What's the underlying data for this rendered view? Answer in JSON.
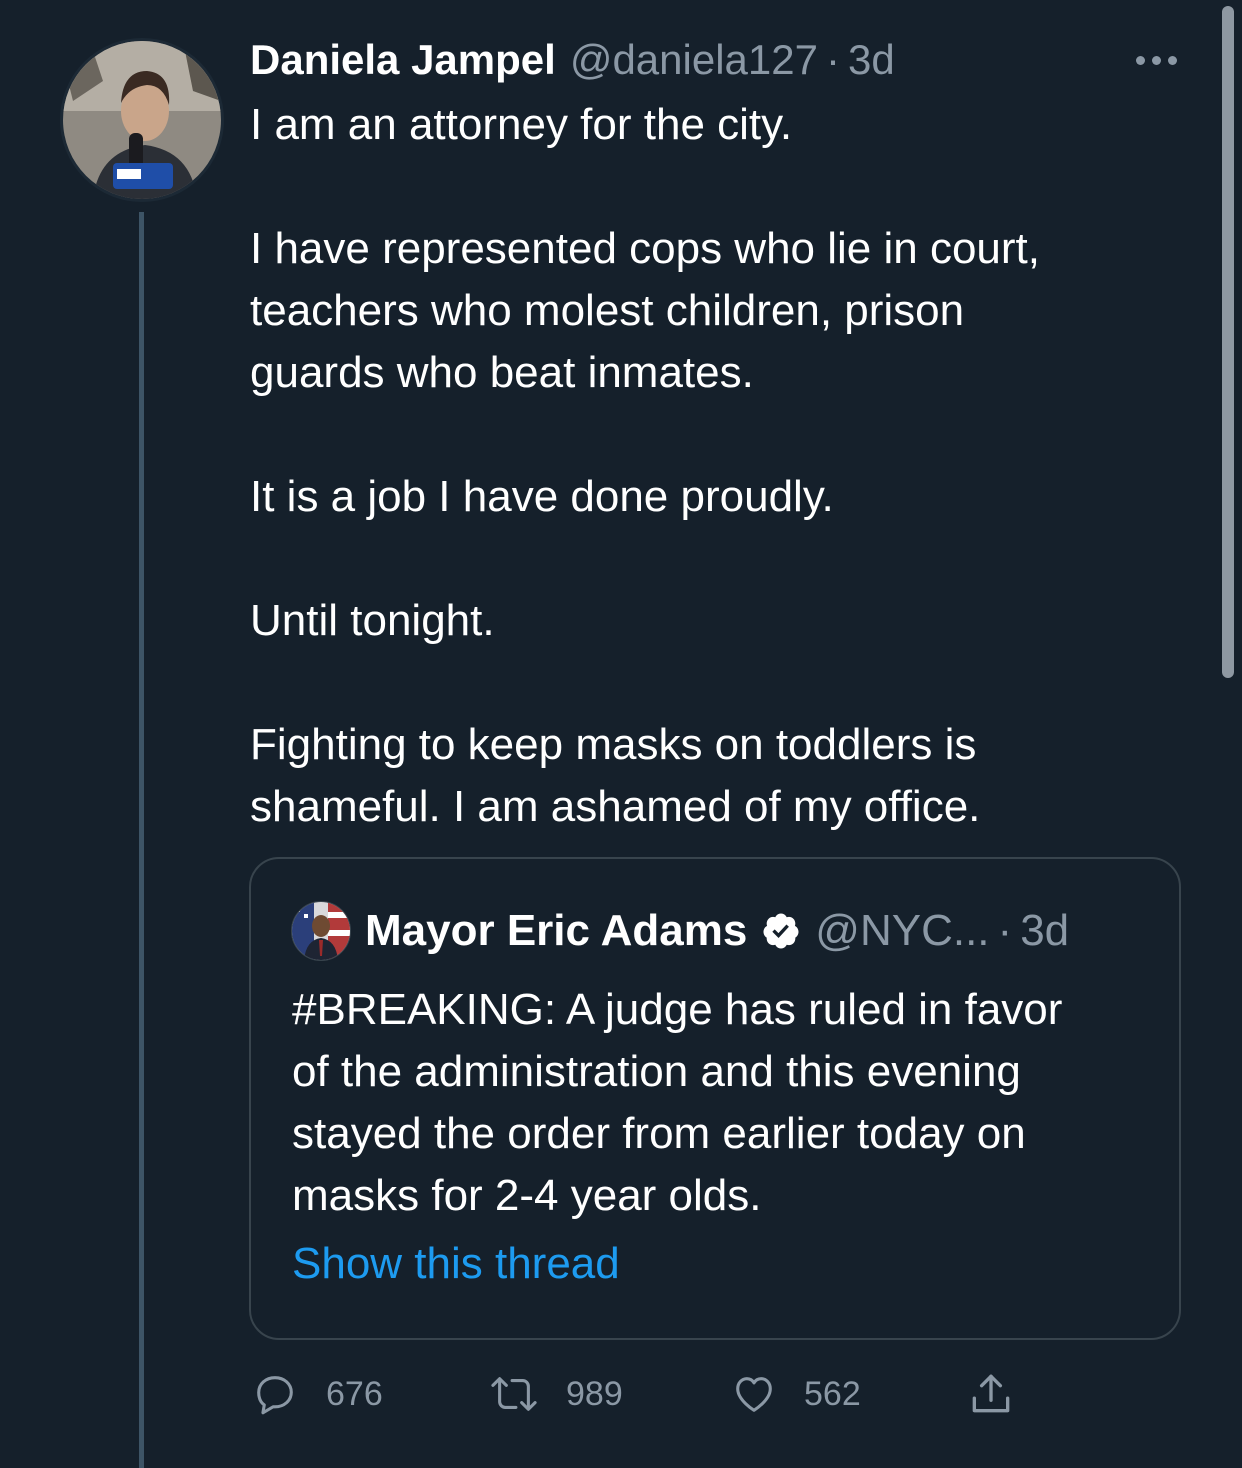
{
  "tweet": {
    "author": {
      "display_name": "Daniela Jampel",
      "handle": "@daniela127",
      "time_sep": "·",
      "time": "3d"
    },
    "more_icon": "more-horizontal-icon",
    "text": {
      "p1": "I am an attorney for the city.",
      "p2_l1": "I have represented cops who lie in court,",
      "p2_l2": "teachers who molest children, prison",
      "p2_l3": "guards who beat inmates.",
      "p3": "It is a job I have done proudly.",
      "p4": "Until tonight.",
      "p5_l1": "Fighting to keep masks on toddlers is",
      "p5_l2": "shameful. I am ashamed of my office."
    },
    "quote": {
      "display_name": "Mayor Eric Adams",
      "verified_icon": "verified-badge-icon",
      "handle": "@NYC...",
      "time_sep": "·",
      "time": "3d",
      "text_l1": "#BREAKING: A judge has ruled in favor",
      "text_l2": "of the administration and this evening",
      "text_l3": "stayed the order from earlier today on",
      "text_l4": "masks for 2-4 year olds.",
      "show_thread": "Show this thread"
    },
    "actions": {
      "reply": {
        "icon": "reply-icon",
        "count": "676"
      },
      "retweet": {
        "icon": "retweet-icon",
        "count": "989"
      },
      "like": {
        "icon": "heart-icon",
        "count": "562"
      },
      "share": {
        "icon": "share-icon"
      }
    }
  },
  "colors": {
    "background": "#15202b",
    "text_primary": "#ffffff",
    "text_secondary": "#8b98a5",
    "link": "#1d9bf0",
    "border": "#38444d",
    "thread_line": "#3d5466"
  }
}
